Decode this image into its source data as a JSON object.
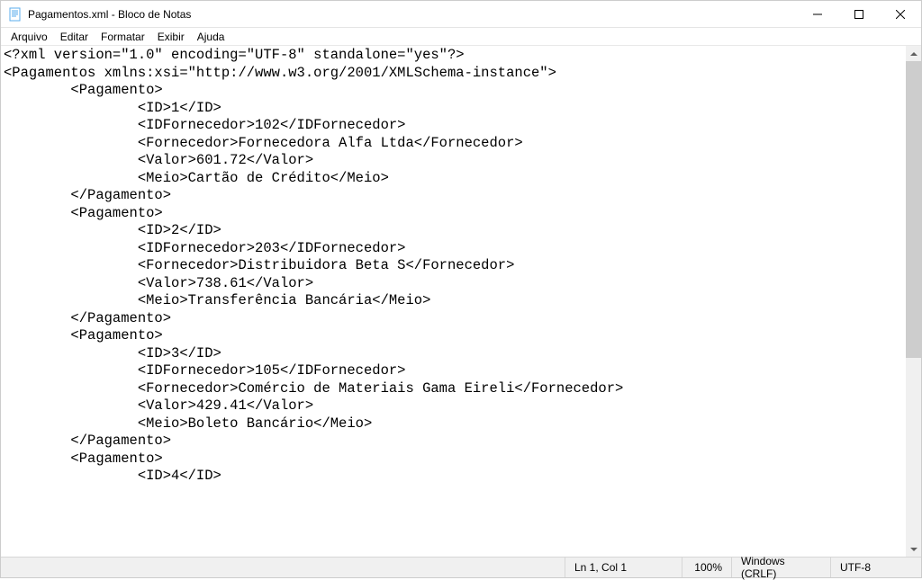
{
  "titlebar": {
    "title": "Pagamentos.xml - Bloco de Notas"
  },
  "menubar": {
    "arquivo": "Arquivo",
    "editar": "Editar",
    "formatar": "Formatar",
    "exibir": "Exibir",
    "ajuda": "Ajuda"
  },
  "editor": {
    "content": "<?xml version=\"1.0\" encoding=\"UTF-8\" standalone=\"yes\"?>\n<Pagamentos xmlns:xsi=\"http://www.w3.org/2001/XMLSchema-instance\">\n        <Pagamento>\n                <ID>1</ID>\n                <IDFornecedor>102</IDFornecedor>\n                <Fornecedor>Fornecedora Alfa Ltda</Fornecedor>\n                <Valor>601.72</Valor>\n                <Meio>Cartão de Crédito</Meio>\n        </Pagamento>\n        <Pagamento>\n                <ID>2</ID>\n                <IDFornecedor>203</IDFornecedor>\n                <Fornecedor>Distribuidora Beta S</Fornecedor>\n                <Valor>738.61</Valor>\n                <Meio>Transferência Bancária</Meio>\n        </Pagamento>\n        <Pagamento>\n                <ID>3</ID>\n                <IDFornecedor>105</IDFornecedor>\n                <Fornecedor>Comércio de Materiais Gama Eireli</Fornecedor>\n                <Valor>429.41</Valor>\n                <Meio>Boleto Bancário</Meio>\n        </Pagamento>\n        <Pagamento>\n                <ID>4</ID>"
  },
  "statusbar": {
    "position": "Ln 1, Col 1",
    "zoom": "100%",
    "lineending": "Windows (CRLF)",
    "encoding": "UTF-8"
  }
}
